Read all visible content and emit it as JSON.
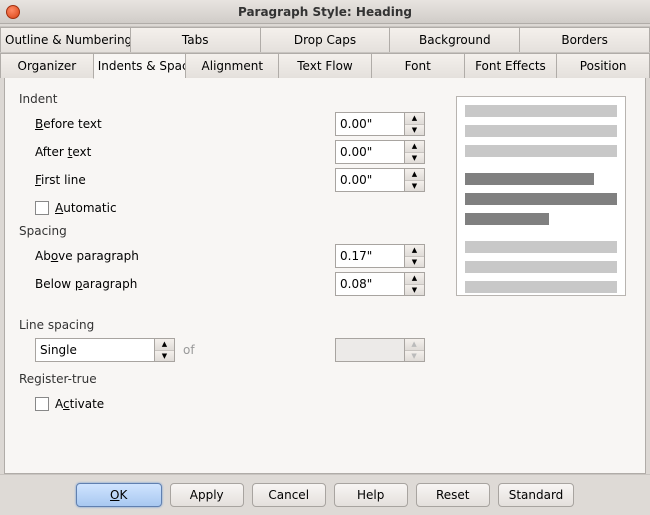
{
  "title": "Paragraph Style: Heading",
  "tabs_row1": [
    "Outline & Numbering",
    "Tabs",
    "Drop Caps",
    "Background",
    "Borders"
  ],
  "tabs_row2": [
    "Organizer",
    "Indents & Spacing",
    "Alignment",
    "Text Flow",
    "Font",
    "Font Effects",
    "Position"
  ],
  "active_tab": "Indents & Spacing",
  "indent": {
    "section": "Indent",
    "before_label": "Before text",
    "before_u": "B",
    "before_val": "0.00\"",
    "after_label": "After text",
    "after_u": "t",
    "after_val": "0.00\"",
    "first_label": "First line",
    "first_u": "F",
    "first_val": "0.00\"",
    "auto_label": "Automatic",
    "auto_u": "A"
  },
  "spacing": {
    "section": "Spacing",
    "above_label": "Above paragraph",
    "above_u": "o",
    "above_val": "0.17\"",
    "below_label": "Below paragraph",
    "below_u": "p",
    "below_val": "0.08\""
  },
  "linespacing": {
    "section": "Line spacing",
    "value": "Single",
    "of": "of",
    "of_val": ""
  },
  "register": {
    "section": "Register-true",
    "activate": "Activate",
    "activate_u": "c"
  },
  "buttons": {
    "ok": "OK",
    "apply": "Apply",
    "cancel": "Cancel",
    "help": "Help",
    "reset": "Reset",
    "standard": "Standard"
  }
}
